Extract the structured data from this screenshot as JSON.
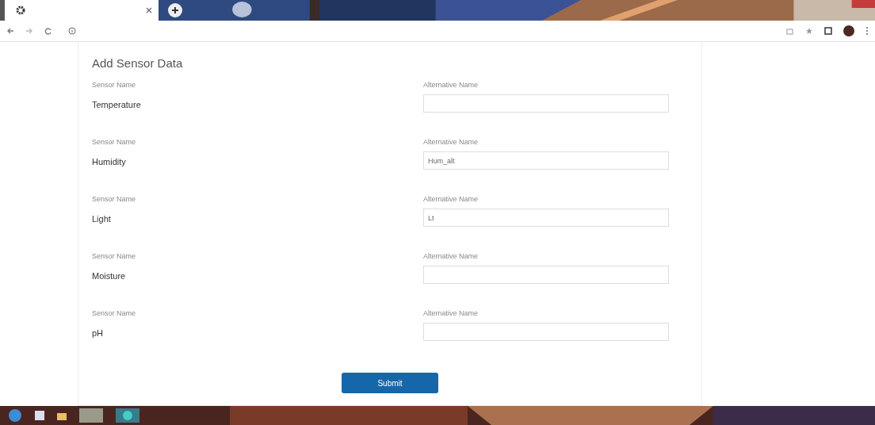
{
  "form": {
    "title": "Add Sensor Data",
    "sensors": [
      {
        "name_label": "Sensor Name",
        "name": "Temperature",
        "alt_label": "Alternative Name"
      },
      {
        "name_label": "Sensor Name",
        "name": "Humidity",
        "alt_label": "Alternative Name",
        "value": "Hum_alt"
      },
      {
        "name_label": "Sensor Name",
        "name": "Light",
        "alt_label": "Alternative Name",
        "value": "Lt"
      },
      {
        "name_label": "Sensor Name",
        "name": "Moisture",
        "alt_label": "Alternative Name"
      },
      {
        "name_label": "Sensor Name",
        "name": "pH",
        "alt_label": "Alternative Name"
      }
    ],
    "submit": "Submit"
  }
}
